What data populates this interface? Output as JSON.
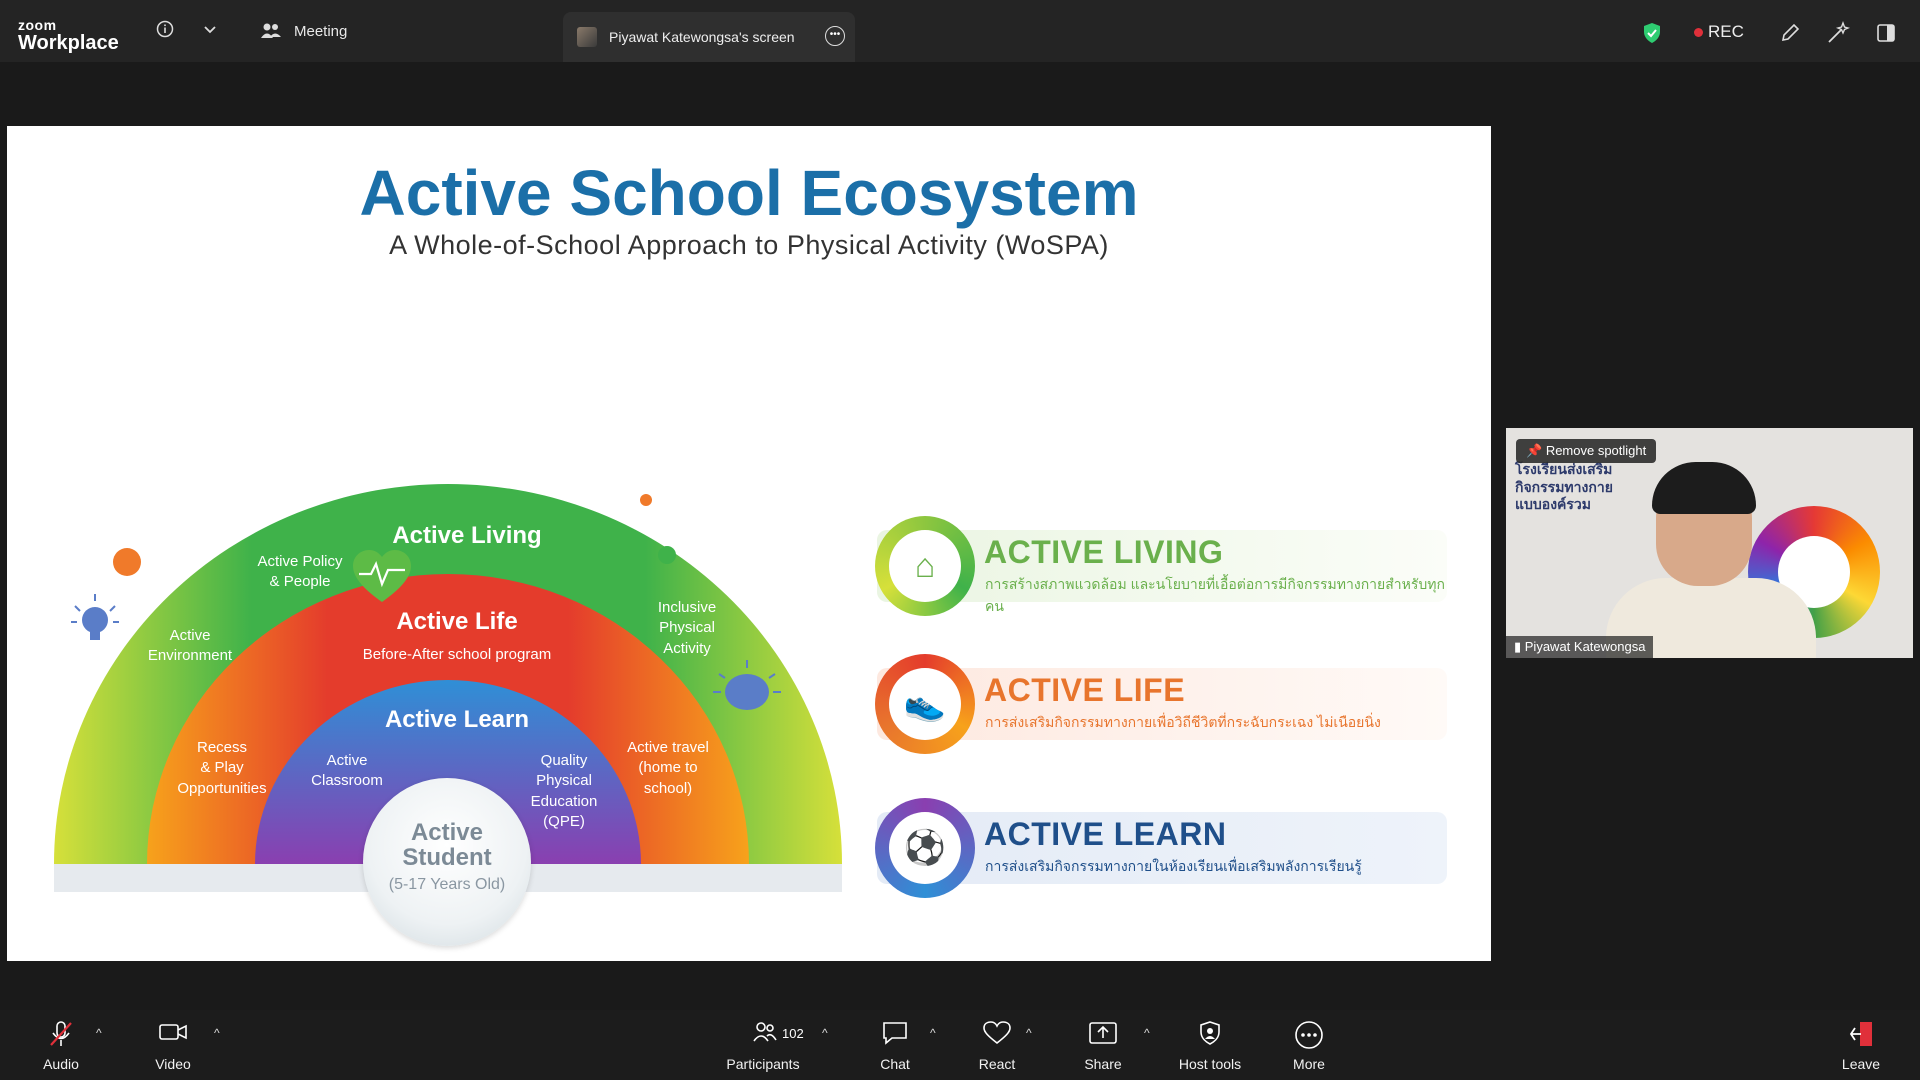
{
  "app": {
    "brand_small": "zoom",
    "brand_big": "Workplace"
  },
  "topbar": {
    "meeting_label": "Meeting",
    "share_tab_label": "Piyawat Katewongsa's screen",
    "rec_label": "REC"
  },
  "slide": {
    "title": "Active School Ecosystem",
    "subtitle": "A Whole-of-School Approach to Physical Activity (WoSPA)",
    "outer": {
      "title": "Active Living",
      "policy": "Active Policy\n& People",
      "environment": "Active\nEnvironment",
      "inclusive": "Inclusive\nPhysical\nActivity"
    },
    "middle": {
      "title": "Active Life",
      "subtitle": "Before-After school program",
      "recess": "Recess\n& Play\nOpportunities",
      "travel": "Active travel\n(home to\nschool)"
    },
    "inner": {
      "title": "Active Learn",
      "classroom": "Active\nClassroom",
      "qpe": "Quality\nPhysical\nEducation\n(QPE)"
    },
    "student": {
      "title": "Active\nStudent",
      "age": "(5-17 Years Old)"
    },
    "pills": [
      {
        "heading": "ACTIVE LIVING",
        "desc": "การสร้างสภาพแวดล้อม และนโยบายที่เอื้อต่อการมีกิจกรรมทางกายสำหรับทุกคน",
        "color": "#6ab04c"
      },
      {
        "heading": "ACTIVE LIFE",
        "desc": "การส่งเสริมกิจกรรมทางกายเพื่อวิถีชีวิตที่กระฉับกระเฉง ไม่เนือยนิ่ง",
        "color": "#e8752d"
      },
      {
        "heading": "ACTIVE LEARN",
        "desc": "การส่งเสริมกิจกรรมทางกายในห้องเรียนเพื่อเสริมพลังการเรียนรู้",
        "color": "#1f4f8a"
      }
    ]
  },
  "video": {
    "spotlight_label": "Remove spotlight",
    "participant_name": "Piyawat Katewongsa",
    "thai_lines": [
      "โรงเรียนส่งเสริม",
      "กิจกรรมทางกาย",
      "แบบองค์รวม"
    ]
  },
  "bottombar": {
    "audio": "Audio",
    "video": "Video",
    "participants": "Participants",
    "participants_count": "102",
    "chat": "Chat",
    "react": "React",
    "share": "Share",
    "host_tools": "Host tools",
    "more": "More",
    "leave": "Leave"
  }
}
